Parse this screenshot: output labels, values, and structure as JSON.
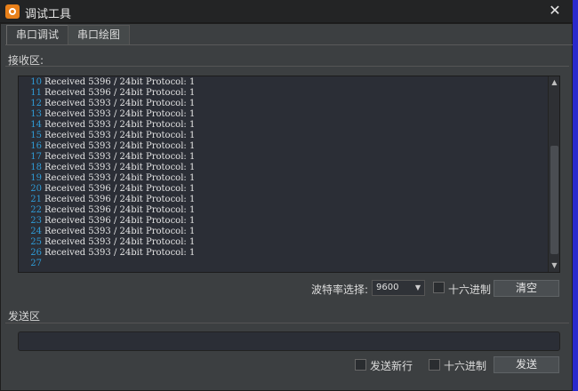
{
  "window": {
    "title": "调试工具",
    "close_glyph": "✕"
  },
  "tabs": [
    {
      "label": "串口调试",
      "active": true
    },
    {
      "label": "串口绘图",
      "active": false
    }
  ],
  "receive": {
    "label": "接收区:",
    "lines": [
      {
        "n": "10",
        "text": "Received 5396 / 24bit Protocol: 1"
      },
      {
        "n": "11",
        "text": "Received 5396 / 24bit Protocol: 1"
      },
      {
        "n": "12",
        "text": "Received 5393 / 24bit Protocol: 1"
      },
      {
        "n": "13",
        "text": "Received 5393 / 24bit Protocol: 1"
      },
      {
        "n": "14",
        "text": "Received 5393 / 24bit Protocol: 1"
      },
      {
        "n": "15",
        "text": "Received 5393 / 24bit Protocol: 1"
      },
      {
        "n": "16",
        "text": "Received 5393 / 24bit Protocol: 1"
      },
      {
        "n": "17",
        "text": "Received 5393 / 24bit Protocol: 1"
      },
      {
        "n": "18",
        "text": "Received 5393 / 24bit Protocol: 1"
      },
      {
        "n": "19",
        "text": "Received 5393 / 24bit Protocol: 1"
      },
      {
        "n": "20",
        "text": "Received 5396 / 24bit Protocol: 1"
      },
      {
        "n": "21",
        "text": "Received 5396 / 24bit Protocol: 1"
      },
      {
        "n": "22",
        "text": "Received 5396 / 24bit Protocol: 1"
      },
      {
        "n": "23",
        "text": "Received 5396 / 24bit Protocol: 1"
      },
      {
        "n": "24",
        "text": "Received 5393 / 24bit Protocol: 1"
      },
      {
        "n": "25",
        "text": "Received 5393 / 24bit Protocol: 1"
      },
      {
        "n": "26",
        "text": "Received 5393 / 24bit Protocol: 1"
      },
      {
        "n": "27",
        "text": ""
      }
    ],
    "baud_label": "波特率选择:",
    "baud_value": "9600",
    "hex_label": "十六进制",
    "clear_label": "清空"
  },
  "send": {
    "label": "发送区",
    "input_value": "",
    "newline_label": "发送新行",
    "hex_label": "十六进制",
    "send_label": "发送"
  },
  "icons": {
    "app": "app-logo-icon",
    "close": "close-icon",
    "scroll_up": "chevron-up-icon",
    "scroll_down": "chevron-down-icon",
    "dropdown": "chevron-down-icon"
  },
  "colors": {
    "titlebar": "#232425",
    "background": "#3c3f41",
    "console_bg": "#2b2e36",
    "line_number": "#2e9bd6",
    "app_icon": "#e8801a",
    "side_strip": "#2a2acc"
  }
}
